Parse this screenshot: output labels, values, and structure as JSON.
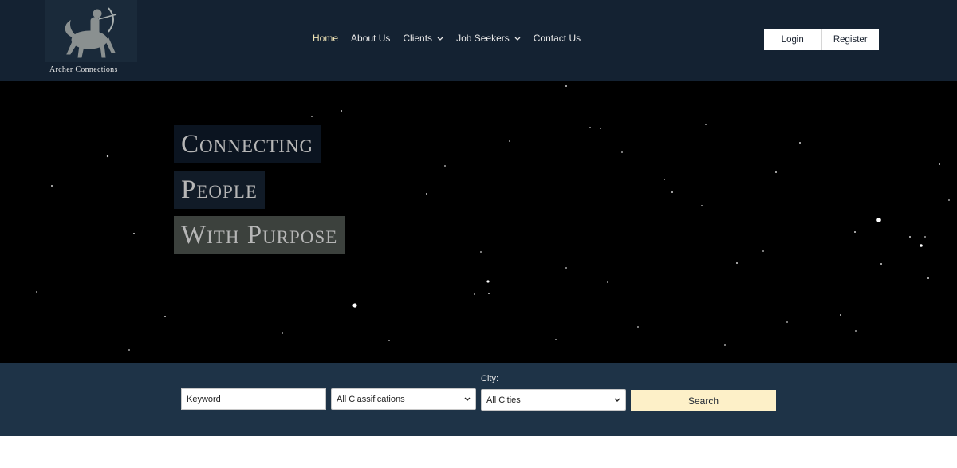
{
  "brand": {
    "logo_text": "Archer Connections",
    "logo_icon": "centaur-archer-icon"
  },
  "nav": {
    "items": [
      {
        "label": "Home",
        "active": true
      },
      {
        "label": "About Us"
      },
      {
        "label": "Clients",
        "dropdown": true
      },
      {
        "label": "Job Seekers",
        "dropdown": true
      },
      {
        "label": "Contact Us"
      }
    ]
  },
  "auth": {
    "login_label": "Login",
    "register_label": "Register"
  },
  "hero": {
    "lines": [
      "Connecting",
      "People",
      "With Purpose"
    ]
  },
  "search": {
    "keyword_placeholder": "Keyword",
    "classification_selected": "All Classifications",
    "city_label": "City:",
    "city_selected": "All Cities",
    "button_label": "Search"
  },
  "colors": {
    "header_bg": "#142232",
    "search_band_bg": "#1e3347",
    "accent_home": "#efe3b5",
    "search_button_bg": "#fdf0c8"
  }
}
